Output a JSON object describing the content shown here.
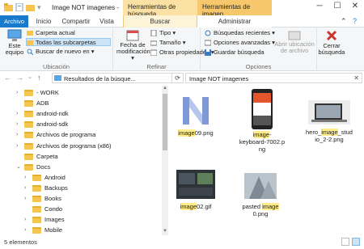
{
  "window": {
    "title": "Image NOT imagenes -",
    "controls": {
      "minimize": "─",
      "maximize": "☐",
      "close": "✕"
    }
  },
  "context_tabs": {
    "search_tools": "Herramientas de búsqueda",
    "image_tools": "Herramientas de imagen"
  },
  "tabs": {
    "file": "Archivo",
    "home": "Inicio",
    "share": "Compartir",
    "view": "Vista",
    "search": "Buscar",
    "manage": "Administrar"
  },
  "ribbon": {
    "location": {
      "label": "Ubicación",
      "this_pc": "Este equipo",
      "current_folder": "Carpeta actual",
      "all_subfolders": "Todas las subcarpetas",
      "search_again": "Buscar de nuevo en ▾"
    },
    "refine": {
      "label": "Refinar",
      "date_modified": "Fecha de modificación ▾",
      "type": "Tipo ▾",
      "size": "Tamaño ▾",
      "other_props": "Otras propiedades ▾"
    },
    "options": {
      "label": "Opciones",
      "recent_searches": "Búsquedas recientes ▾",
      "advanced_options": "Opciones avanzadas ▾",
      "save_search": "Guardar búsqueda",
      "open_location": "Abrir ubicación de archivo"
    },
    "close": {
      "label": "Cerrar búsqueda"
    }
  },
  "address": {
    "path": "Resultados de la búsque...",
    "search_value": "Image NOT imagenes"
  },
  "nav": {
    "items": [
      {
        "label": "- WORK",
        "level": 1,
        "chev": ">"
      },
      {
        "label": "ADB",
        "level": 1,
        "chev": ""
      },
      {
        "label": "android-ndk",
        "level": 1,
        "chev": ">"
      },
      {
        "label": "android-sdk",
        "level": 1,
        "chev": ">"
      },
      {
        "label": "Archivos de programa",
        "level": 1,
        "chev": ">"
      },
      {
        "label": "Archivos de programa (x86)",
        "level": 1,
        "chev": ">"
      },
      {
        "label": "Carpeta",
        "level": 1,
        "chev": ""
      },
      {
        "label": "Docs",
        "level": 1,
        "chev": "v"
      },
      {
        "label": "Android",
        "level": 2,
        "chev": ">"
      },
      {
        "label": "Backups",
        "level": 2,
        "chev": ">"
      },
      {
        "label": "Books",
        "level": 2,
        "chev": ">"
      },
      {
        "label": "Condo",
        "level": 2,
        "chev": ""
      },
      {
        "label": "Images",
        "level": 2,
        "chev": ">"
      },
      {
        "label": "Mobile",
        "level": 2,
        "chev": ">"
      }
    ]
  },
  "files": [
    {
      "name_lines": [
        "image09.png"
      ],
      "highlight": "image"
    },
    {
      "name_lines": [
        "image-",
        "keyboard-7002.p",
        "ng"
      ],
      "highlight": "image"
    },
    {
      "name_lines": [
        "hero_image_stud",
        "io_2-2.png"
      ],
      "highlight": "image"
    },
    {
      "name_lines": [
        "image02.gif"
      ],
      "highlight": "image"
    },
    {
      "name_lines": [
        "pasted image",
        "0.png"
      ],
      "highlight": "image"
    }
  ],
  "status": {
    "count": "5 elementos"
  },
  "colors": {
    "file_tab": "#1979ca",
    "search_context": "#fbe2a4",
    "image_context": "#f7c86b",
    "folder": "#f4c650",
    "match_highlight": "#ffec8c"
  }
}
